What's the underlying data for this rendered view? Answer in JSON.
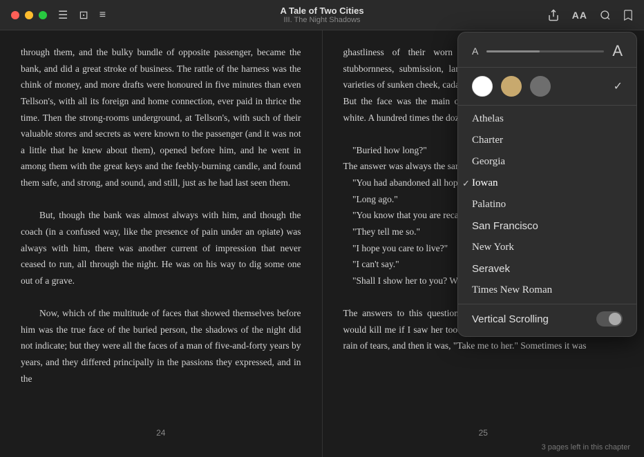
{
  "window": {
    "title": "A Tale of Two Cities",
    "subtitle": "III. The Night Shadows"
  },
  "toolbar": {
    "left_icons": [
      "list-icon",
      "sidebar-icon",
      "reader-icon"
    ],
    "right_icons": [
      "share-icon",
      "font-icon",
      "search-icon",
      "bookmark-icon"
    ]
  },
  "page_left": {
    "number": "24",
    "text": "through them, and the bulky bundle of opposite passenger, became the bank, and did a great stroke of business. The rattle of the harness was the chink of money, and more drafts were honoured in five minutes than even Tellson's, with all its foreign and home connection, ever paid in thrice the time. Then the strong-rooms underground, at Tellson's, with such of their valuable stores and secrets as were known to the passenger (and it was not a little that he knew about them), opened before him, and he went in among them with the great keys and the feebly-burning candle, and found them safe, and strong, and sound, and still, just as he had last seen them.\n\nBut, though the bank was almost always with him, and though the coach (in a confused way, like the presence of pain under an opiate) was always with him, there was another current of impression that never ceased to run, all through the night. He was on his way to dig some one out of a grave.\n\nNow, which of the multitude of faces that showed themselves before him was the true face of the buried person, the shadows of the night did not indicate; but they were all the faces of a man of five-and-forty years by years, and they differed principally in the passions they expressed, and in the"
  },
  "page_right": {
    "number": "25",
    "text": "ghastliness of their worn and wasted state, contempt, defiance, stubbornness, submission, lamentation, succeeded one another; so did varieties of sunken cheek, cadaverous colour, emaciated hands and figures. But the face was the main one face, and every head was prematurely white. A hundred times the dozing passenger inquired of this spectre:",
    "dialogue": [
      "\"Buried how long?\"",
      "The answer was always the same: \"Almost eighteen years.\"",
      "\"You had abandoned all hope of being dug out?\"",
      "\"Long ago.\"",
      "\"You know that you are recalled to life?\"",
      "\"They tell me so.\"",
      "\"I hope you care to live?\"",
      "\"I can't say.\"",
      "\"Shall I show her to you? Will you come and see her?\""
    ],
    "text2": "The answers to this question were contradictory. Sometimes the answer was \"Wait! It would kill me if I saw her too soon.\" Sometimes, it was given in a tender rain of tears, and then it was, \"Take me to her.\" Sometimes it was"
  },
  "font_panel": {
    "size_label_small": "A",
    "size_label_large": "A",
    "themes": [
      {
        "name": "white",
        "color": "#ffffff"
      },
      {
        "name": "sepia",
        "color": "#c8a96e"
      },
      {
        "name": "gray",
        "color": "#6e6e6e"
      }
    ],
    "fonts": [
      {
        "name": "Athelas",
        "selected": false
      },
      {
        "name": "Charter",
        "selected": false
      },
      {
        "name": "Georgia",
        "selected": false
      },
      {
        "name": "Iowan",
        "selected": true
      },
      {
        "name": "Palatino",
        "selected": false
      },
      {
        "name": "San Francisco",
        "selected": false
      },
      {
        "name": "New York",
        "selected": false
      },
      {
        "name": "Seravek",
        "selected": false
      },
      {
        "name": "Times New Roman",
        "selected": false
      }
    ],
    "vertical_scrolling_label": "Vertical Scrolling"
  },
  "status": {
    "pages_left": "3 pages left in this chapter"
  }
}
